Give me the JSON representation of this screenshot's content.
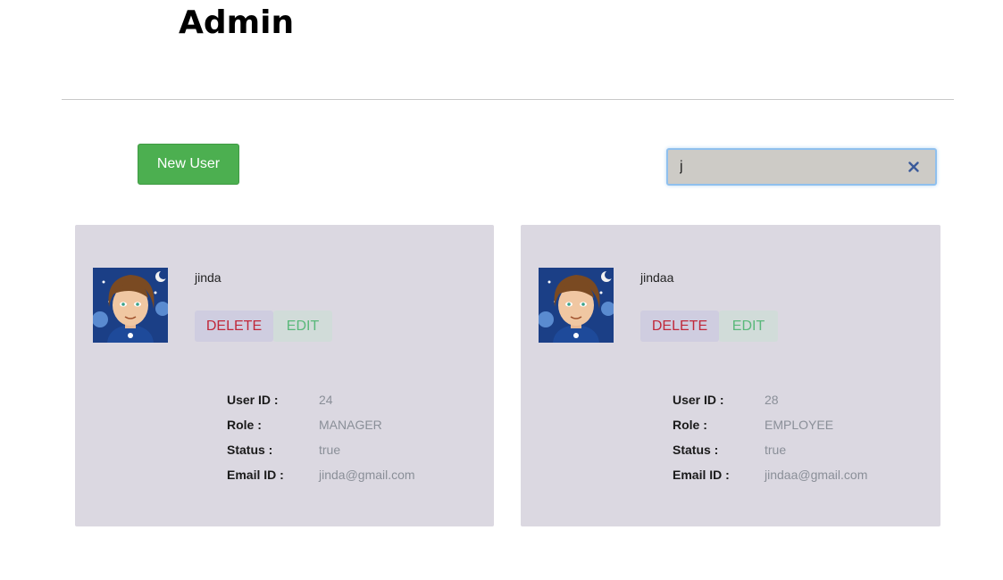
{
  "header": {
    "title": "Admin"
  },
  "toolbar": {
    "new_user_label": "New User",
    "search_value": "j",
    "search_clear_icon": "close-icon"
  },
  "labels": {
    "user_id": "User ID :",
    "role": "Role :",
    "status": "Status :",
    "email": "Email ID :"
  },
  "cards": [
    {
      "username": "jinda",
      "delete_label": "DELETE",
      "edit_label": "EDIT",
      "user_id": "24",
      "role": "MANAGER",
      "status": "true",
      "email": "jinda@gmail.com"
    },
    {
      "username": "jindaa",
      "delete_label": "DELETE",
      "edit_label": "EDIT",
      "user_id": "28",
      "role": "EMPLOYEE",
      "status": "true",
      "email": "jindaa@gmail.com"
    }
  ],
  "colors": {
    "new_user_bg": "#4caf50",
    "card_bg": "#dbd8e1",
    "delete_text": "#c0283a",
    "edit_text": "#59b87a",
    "search_bg": "#cdcbc6",
    "clear_icon": "#3a5a9a"
  }
}
